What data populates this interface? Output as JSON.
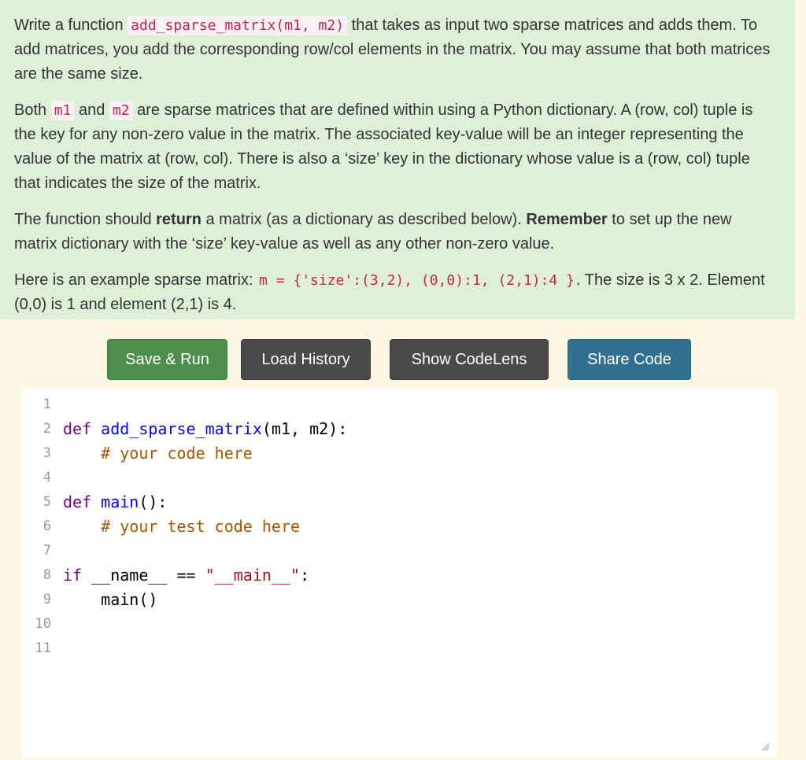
{
  "question": {
    "p1": {
      "t1": "Write a function ",
      "code1": "add_sparse_matrix(m1, m2)",
      "t2": " that takes as input two sparse matrices and adds them. To add matrices, you add the corresponding row/col elements in the matrix. You may assume that both matrices are the same size."
    },
    "p2": {
      "t1": "Both ",
      "code1": "m1",
      "t2": " and ",
      "code2": "m2",
      "t3": " are sparse matrices that are defined within using a Python dictionary. A (row, col) tuple is the key for any non-zero value in the matrix. The associated key-value will be an integer representing the value of the matrix at (row, col). There is also a ‘size’ key in the dictionary whose value is a (row, col) tuple that indicates the size of the matrix."
    },
    "p3": {
      "t1": "The function should ",
      "b1": "return",
      "t2": " a matrix (as a dictionary as described below). ",
      "b2": "Remember",
      "t3": " to set up the new matrix dictionary with the ‘size’ key-value as well as any other non-zero value."
    },
    "p4": {
      "t1": "Here is an example sparse matrix: ",
      "code1": "m = {'size':(3,2), (0,0):1, (2,1):4 }",
      "t2": ". The size is 3 x 2. Element (0,0) is 1 and element (2,1) is 4."
    }
  },
  "toolbar": {
    "save_run": "Save & Run",
    "load_history": "Load History",
    "show_codelens": "Show CodeLens",
    "share_code": "Share Code"
  },
  "editor": {
    "line_numbers": [
      "1",
      "2",
      "3",
      "4",
      "5",
      "6",
      "7",
      "8",
      "9",
      "10",
      "11"
    ],
    "code": {
      "l2_kw": "def",
      "l2_fn": "add_sparse_matrix",
      "l2_rest": "(m1, m2):",
      "l3_indent": "    ",
      "l3_comment": "# your code here",
      "l5_kw": "def",
      "l5_fn": "main",
      "l5_rest": "():",
      "l6_indent": "    ",
      "l6_comment": "# your test code here",
      "l8_kw": "if",
      "l8_mid": " __name__ == ",
      "l8_str": "\"__main__\"",
      "l8_end": ":",
      "l9": "    main()"
    }
  },
  "colors": {
    "question_bg": "#dff0d8",
    "page_bg": "#fcf8e3",
    "save_button": "#4e8f4e",
    "dark_button": "#4a4a4a",
    "share_button": "#31708f",
    "keyword": "#770088",
    "function_name": "#0000ff",
    "comment": "#aa5500",
    "string": "#aa1111",
    "inline_code": "#c7254e"
  }
}
